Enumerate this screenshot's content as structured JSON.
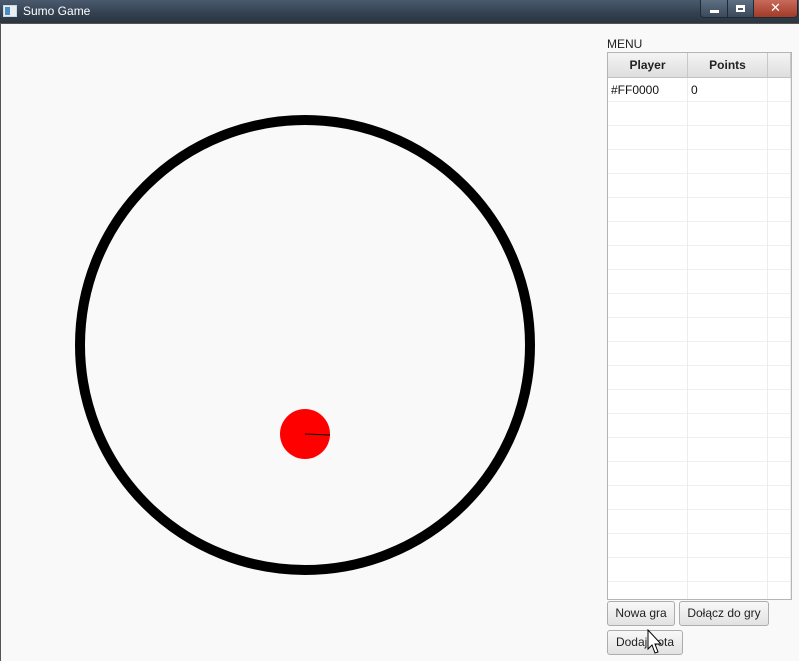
{
  "window": {
    "title": "Sumo Game",
    "buttons": {
      "minimize_icon": "minimize-icon",
      "maximize_icon": "maximize-icon",
      "close_icon": "close-icon"
    }
  },
  "game": {
    "ring_color": "#000000",
    "player_color": "#FF0000"
  },
  "menu": {
    "label": "MENU",
    "table": {
      "headers": [
        "Player",
        "Points"
      ],
      "rows": [
        {
          "player": "#FF0000",
          "points": "0"
        }
      ]
    },
    "buttons": {
      "new_game": "Nowa gra",
      "join_game": "Dołącz do gry",
      "add_bot": "Dodaj bota"
    }
  },
  "colors": {
    "background": "#f9f9f9",
    "titlebar": "#33404f"
  }
}
